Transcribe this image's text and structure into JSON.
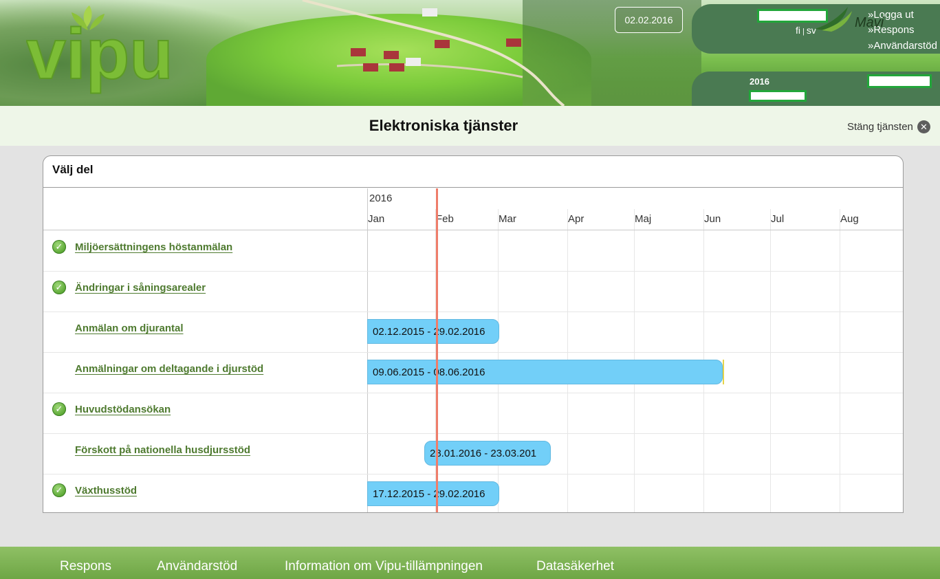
{
  "header": {
    "logo_text": "vipu",
    "date": "02.02.2016",
    "lang_fi": "fi",
    "lang_sep": "|",
    "lang_sv": "sv",
    "links": [
      "»Logga ut",
      "»Respons",
      "»Användarstöd"
    ],
    "year": "2016"
  },
  "titlebar": {
    "title": "Elektroniska tjänster",
    "close_label": "Stäng tjänsten",
    "close_icon": "close-icon"
  },
  "card": {
    "title": "Välj del",
    "year": "2016",
    "months": [
      "Jan",
      "Feb",
      "Mar",
      "Apr",
      "Maj",
      "Jun",
      "Jul",
      "Aug"
    ],
    "rows": [
      {
        "label": "Miljöersättningens höstanmälan",
        "checked": true,
        "bar": ""
      },
      {
        "label": "Ändringar i såningsarealer",
        "checked": true,
        "bar": ""
      },
      {
        "label": "Anmälan om djurantal",
        "checked": false,
        "bar": "02.12.2015 - 29.02.2016"
      },
      {
        "label": "Anmälningar om deltagande i djurstöd",
        "checked": false,
        "bar": "09.06.2015 - 08.06.2016"
      },
      {
        "label": "Huvudstödansökan",
        "checked": true,
        "bar": ""
      },
      {
        "label": "Förskott på nationella husdjursstöd",
        "checked": false,
        "bar": "28.01.2016 - 23.03.201"
      },
      {
        "label": "Växthusstöd",
        "checked": true,
        "bar": "17.12.2015 - 29.02.2016"
      }
    ]
  },
  "footer": {
    "links": [
      "Respons",
      "Användarstöd",
      "Information om Vipu-tillämpningen",
      "Datasäkerhet"
    ],
    "logo_text": "Mavi"
  },
  "colors": {
    "bar": "#72cff8",
    "today_line": "#ef7d6a",
    "link": "#4e7a2f",
    "panel": "#4a7a52",
    "footer": "#7ab04f"
  }
}
